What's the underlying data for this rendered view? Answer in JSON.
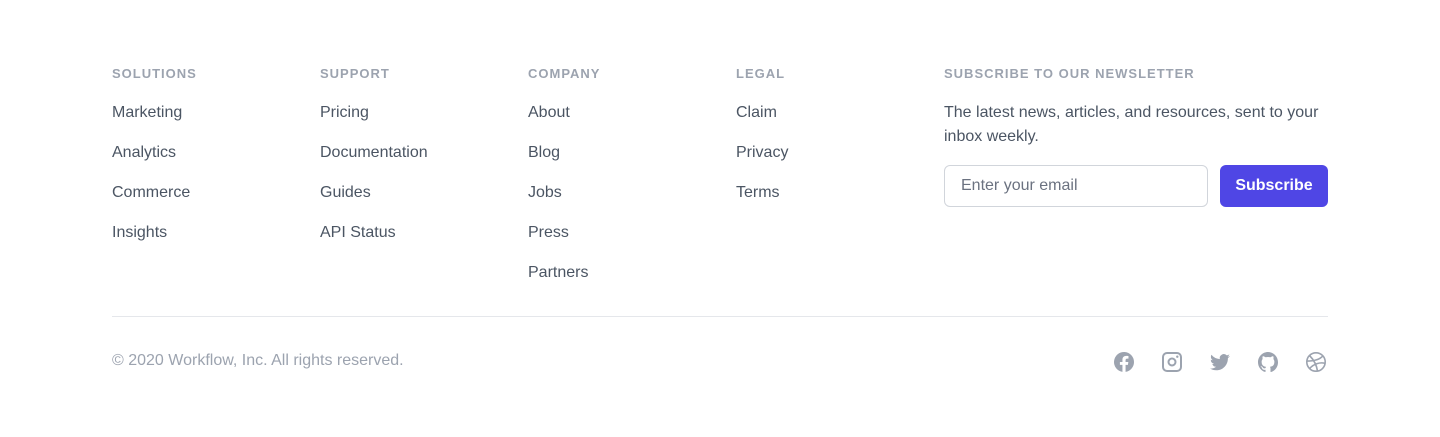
{
  "columns": [
    {
      "title": "Solutions",
      "links": [
        "Marketing",
        "Analytics",
        "Commerce",
        "Insights"
      ]
    },
    {
      "title": "Support",
      "links": [
        "Pricing",
        "Documentation",
        "Guides",
        "API Status"
      ]
    },
    {
      "title": "Company",
      "links": [
        "About",
        "Blog",
        "Jobs",
        "Press",
        "Partners"
      ]
    },
    {
      "title": "Legal",
      "links": [
        "Claim",
        "Privacy",
        "Terms"
      ]
    }
  ],
  "newsletter": {
    "title": "SUBSCRIBE TO OUR NEWSLETTER",
    "description": "The latest news, articles, and resources, sent to your inbox weekly.",
    "placeholder": "Enter your email",
    "button": "Subscribe"
  },
  "copyright": "© 2020 Workflow, Inc. All rights reserved.",
  "social": [
    "facebook-icon",
    "instagram-icon",
    "twitter-icon",
    "github-icon",
    "dribbble-icon"
  ],
  "colors": {
    "accent": "#4f46e5",
    "muted": "#9ca3af",
    "text": "#4b5563"
  }
}
